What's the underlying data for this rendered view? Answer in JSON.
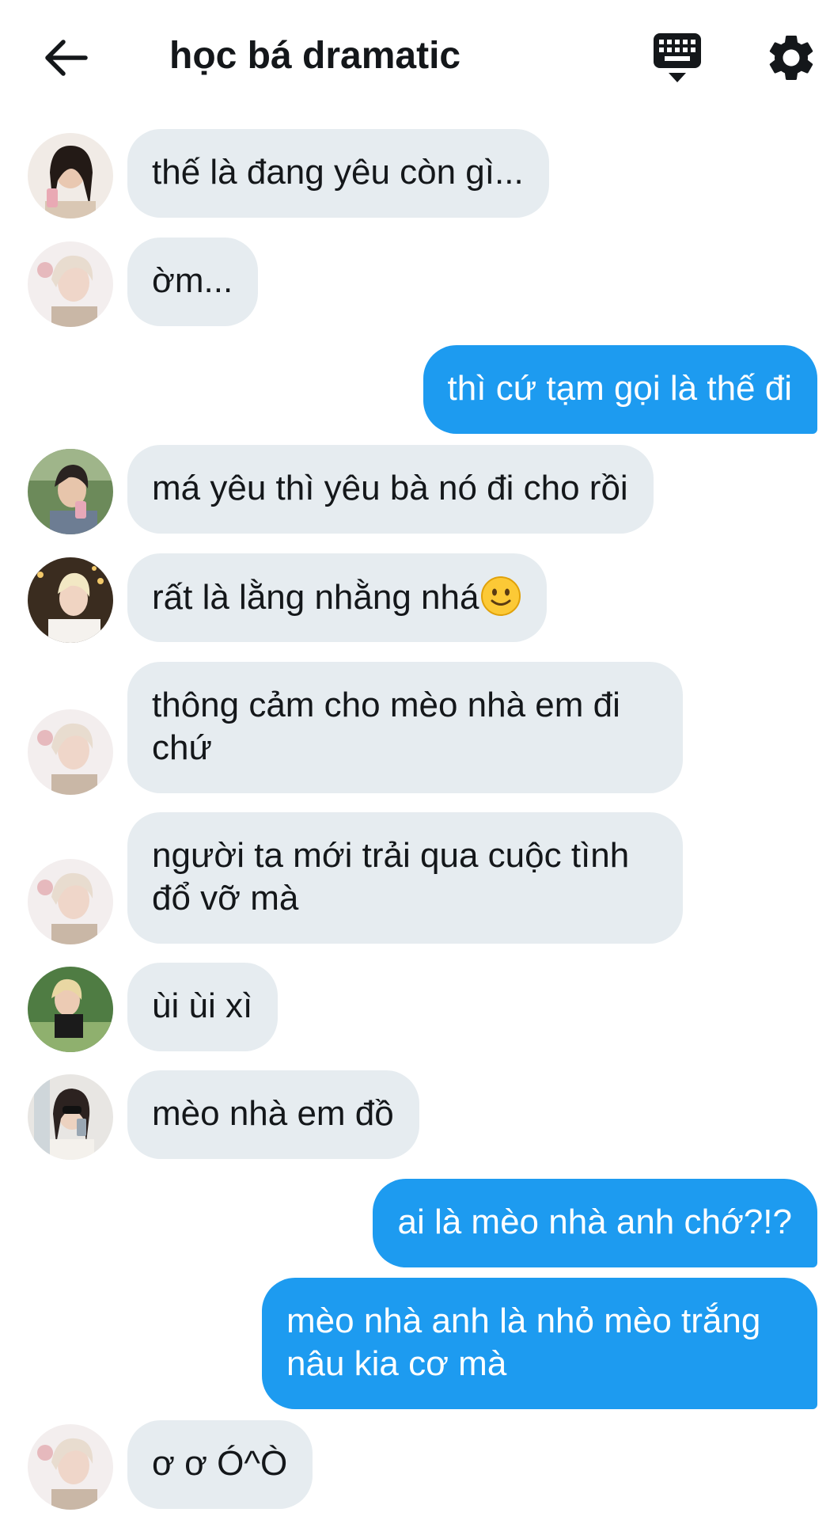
{
  "header": {
    "title": "học bá dramatic",
    "back_icon": "arrow-left-icon",
    "keyboard_icon": "keyboard-icon",
    "settings_icon": "gear-icon"
  },
  "colors": {
    "incoming_bubble": "#e6ecf0",
    "outgoing_bubble": "#1d9bf0",
    "text": "#14171a"
  },
  "messages": [
    {
      "direction": "in",
      "text": "thế là đang yêu còn gì..."
    },
    {
      "direction": "in",
      "text": "ờm..."
    },
    {
      "direction": "out",
      "text": "thì cứ tạm gọi là thế đi"
    },
    {
      "direction": "in",
      "text": "má yêu thì yêu bà nó đi cho rồi"
    },
    {
      "direction": "in",
      "text": "rất là lằng nhằng nhá",
      "emoji": "slightly-smiling-face"
    },
    {
      "direction": "in",
      "text": "thông cảm cho mèo nhà em đi chứ"
    },
    {
      "direction": "in",
      "text": "người ta mới trải qua cuộc tình đổ vỡ mà"
    },
    {
      "direction": "in",
      "text": "ùi ùi xì"
    },
    {
      "direction": "in",
      "text": "mèo nhà em đồ"
    },
    {
      "direction": "out",
      "text": "ai là mèo nhà anh chớ?!?"
    },
    {
      "direction": "out",
      "text": "mèo nhà anh là nhỏ mèo trắng nâu kia cơ mà"
    },
    {
      "direction": "in",
      "text": "ơ ơ Ó^Ò"
    }
  ]
}
